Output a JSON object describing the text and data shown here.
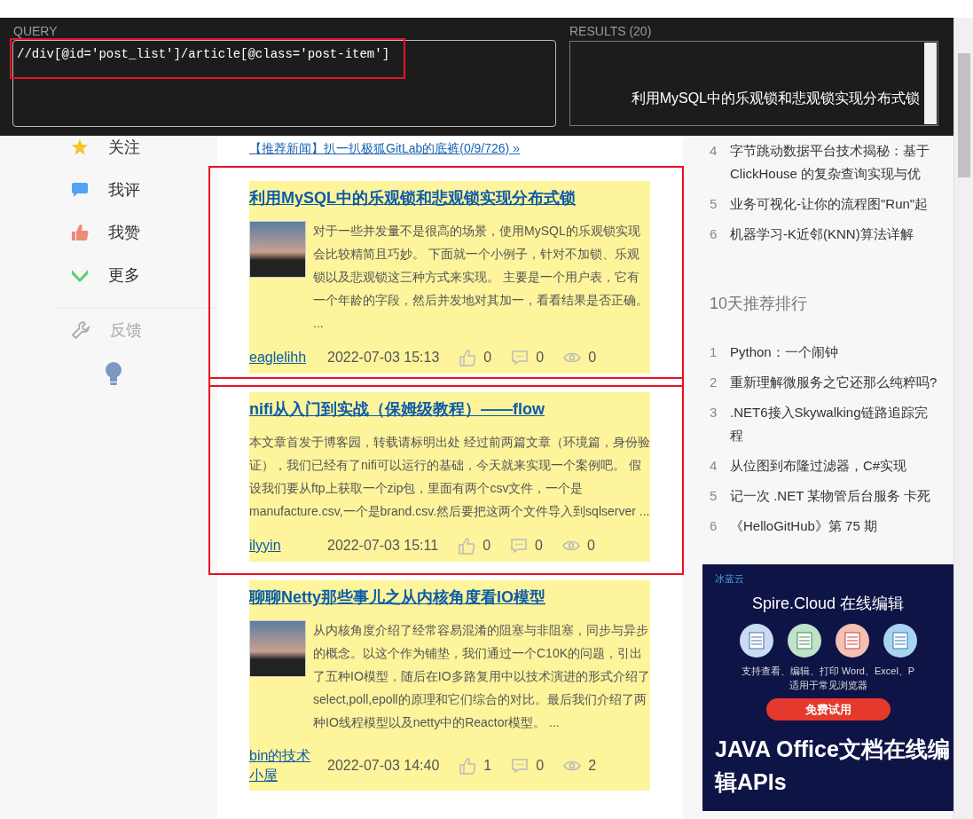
{
  "xpath_helper": {
    "query_label": "QUERY",
    "query": "//div[@id='post_list']/article[@class='post-item']",
    "query_highlighted": true,
    "results_label": "RESULTS (20)",
    "result": "利用MySQL中的乐观锁和悲观锁实现分布式锁"
  },
  "sidebar": {
    "items": [
      {
        "kind": "star",
        "label": "关注",
        "disabled": false
      },
      {
        "kind": "comment",
        "label": "我评",
        "disabled": false
      },
      {
        "kind": "like",
        "label": "我赞",
        "disabled": false
      },
      {
        "kind": "more",
        "label": "更多",
        "disabled": false
      },
      {
        "kind": "wrench",
        "label": "反馈",
        "disabled": true
      }
    ]
  },
  "news": [
    "【推荐新闻】扒一扒极狐GitLab的底裤(0/9/726) »"
  ],
  "posts": [
    {
      "title": "利用MySQL中的乐观锁和悲观锁实现分布式锁",
      "thumbnail": true,
      "summary": "对于一些并发量不是很高的场景，使用MySQL的乐观锁实现会比较精简且巧妙。 下面就一个小例子，针对不加锁、乐观锁以及悲观锁这三种方式来实现。 主要是一个用户表，它有一个年龄的字段，然后并发地对其加一，看看结果是否正确。 ...",
      "author": "eaglelihh",
      "date": "2022-07-03 15:13",
      "likes": "0",
      "comments": "0",
      "views": "0",
      "highlighted": true
    },
    {
      "title": "nifi从入门到实战（保姆级教程）——flow",
      "thumbnail": false,
      "summary": "本文章首发于博客园，转载请标明出处 经过前两篇文章（环境篇，身份验证），我们已经有了nifi可以运行的基础，今天就来实现一个案例吧。 假设我们要从ftp上获取一个zip包，里面有两个csv文件，一个是manufacture.csv,一个是brand.csv.然后要把这两个文件导入到sqlserver ...",
      "author": "ilyyin",
      "date": "2022-07-03 15:11",
      "likes": "0",
      "comments": "0",
      "views": "0",
      "highlighted": true
    },
    {
      "title": "聊聊Netty那些事儿之从内核角度看IO模型",
      "thumbnail": true,
      "summary": "从内核角度介绍了经常容易混淆的阻塞与非阻塞，同步与异步的概念。以这个作为铺垫，我们通过一个C10K的问题，引出了五种IO模型，随后在IO多路复用中以技术演进的形式介绍了select,poll,epoll的原理和它们综合的对比。最后我们介绍了两种IO线程模型以及netty中的Reactor模型。 ...",
      "author": "bin的技术小屋",
      "date": "2022-07-03 14:40",
      "likes": "1",
      "comments": "0",
      "views": "2",
      "highlighted": false
    }
  ],
  "hot_list": [
    {
      "number": "4",
      "lines": [
        "字节跳动数据平台技术揭秘：基于",
        "ClickHouse 的复杂查询实现与优"
      ]
    },
    {
      "number": "5",
      "lines": [
        "业务可视化-让你的流程图\"Run\"起"
      ]
    },
    {
      "number": "6",
      "lines": [
        "机器学习-K近邻(KNN)算法详解"
      ]
    }
  ],
  "ranking": {
    "title": "10天推荐排行",
    "items": [
      {
        "number": "1",
        "lines": [
          "Python：一个闹钟"
        ]
      },
      {
        "number": "2",
        "lines": [
          "重新理解微服务之它还那么纯粹吗?"
        ]
      },
      {
        "number": "3",
        "lines": [
          ".NET6接入Skywalking链路追踪完",
          "程"
        ]
      },
      {
        "number": "4",
        "lines": [
          "从位图到布隆过滤器，C#实现"
        ]
      },
      {
        "number": "5",
        "lines": [
          "记一次 .NET 某物管后台服务 卡死"
        ]
      },
      {
        "number": "6",
        "lines": [
          "《HelloGitHub》第 75 期"
        ]
      }
    ]
  },
  "ad": {
    "logo": "冰蓝云",
    "headline": "Spire.Cloud 在线编辑",
    "features": "支持查看、编辑、打印 Word、Excel、P",
    "sub": "适用于常见浏览器",
    "button": "免费试用",
    "title": "JAVA Office文档在线编辑APIs"
  }
}
